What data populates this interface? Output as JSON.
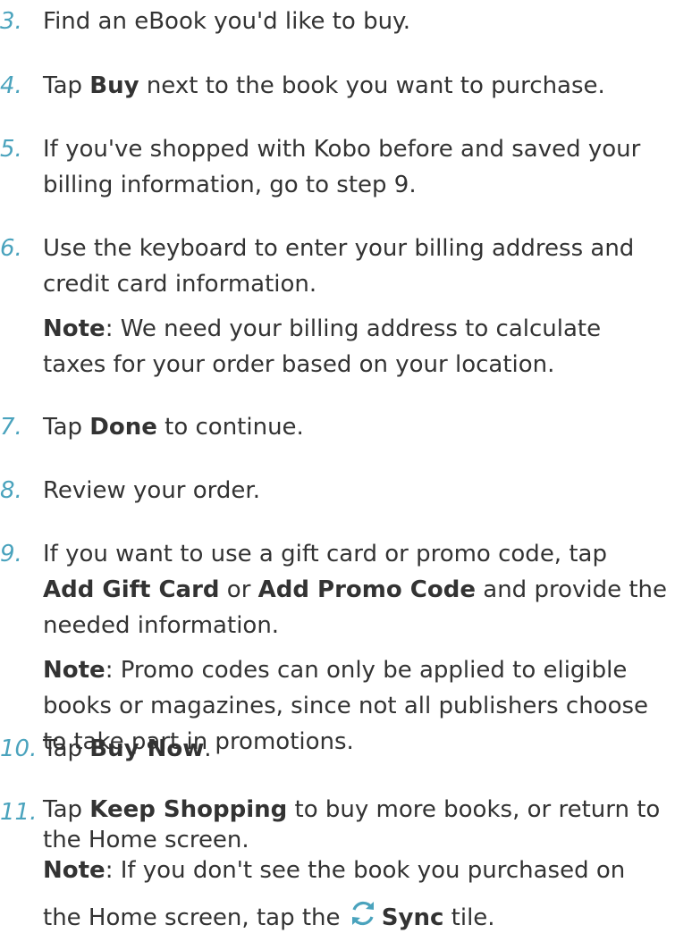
{
  "steps": [
    {
      "num": "3.",
      "lines": [
        [
          {
            "t": "Find an eBook you'd like to buy."
          }
        ]
      ]
    },
    {
      "num": "4.",
      "lines": [
        [
          {
            "t": "Tap "
          },
          {
            "t": "Buy",
            "b": true
          },
          {
            "t": " next to the book you want to purchase."
          }
        ]
      ]
    },
    {
      "num": "5.",
      "lines": [
        [
          {
            "t": "If you've shopped with Kobo before and saved your"
          }
        ],
        [
          {
            "t": "billing information, go to step 9."
          }
        ]
      ]
    },
    {
      "num": "6.",
      "lines": [
        [
          {
            "t": "Use the keyboard to enter your billing address and"
          }
        ],
        [
          {
            "t": "credit card information."
          }
        ]
      ],
      "note": [
        [
          {
            "t": "Note",
            "b": true
          },
          {
            "t": ": We need your billing address to calculate"
          }
        ],
        [
          {
            "t": "taxes for your order based on your location."
          }
        ]
      ]
    },
    {
      "num": "7.",
      "lines": [
        [
          {
            "t": "Tap "
          },
          {
            "t": "Done",
            "b": true
          },
          {
            "t": " to continue."
          }
        ]
      ]
    },
    {
      "num": "8.",
      "lines": [
        [
          {
            "t": "Review your order."
          }
        ]
      ]
    },
    {
      "num": "9.",
      "lines": [
        [
          {
            "t": "If you want to use a gift card or promo code, tap"
          }
        ],
        [
          {
            "t": "Add Gift Card",
            "b": true
          },
          {
            "t": " or "
          },
          {
            "t": "Add Promo Code",
            "b": true
          },
          {
            "t": " and provide the"
          }
        ],
        [
          {
            "t": "needed information."
          }
        ]
      ],
      "note": [
        [
          {
            "t": "Note",
            "b": true
          },
          {
            "t": ": Promo codes can only be applied to eligible"
          }
        ],
        [
          {
            "t": "books or magazines, since not all publishers choose"
          }
        ],
        [
          {
            "t": "to take part in promotions."
          }
        ]
      ]
    },
    {
      "num": "10.",
      "lines": [
        [
          {
            "t": "Tap "
          },
          {
            "t": "Buy Now",
            "b": true
          },
          {
            "t": "."
          }
        ]
      ]
    },
    {
      "num": "11.",
      "lines": [
        [
          {
            "t": "Tap "
          },
          {
            "t": "Keep Shopping",
            "b": true
          },
          {
            "t": " to buy more books, or return to"
          }
        ],
        [
          {
            "t": "the Home screen."
          }
        ]
      ],
      "note_inline": [
        [
          {
            "t": "Note",
            "b": true
          },
          {
            "t": ": If you don't see the book you purchased on"
          }
        ]
      ],
      "final_line": {
        "before": "the Home screen, tap the ",
        "icon": "sync-icon",
        "bold": "Sync",
        "after": " tile."
      }
    }
  ],
  "colors": {
    "number": "#4aa3bd",
    "text": "#333333",
    "icon": "#4aa3bd"
  }
}
